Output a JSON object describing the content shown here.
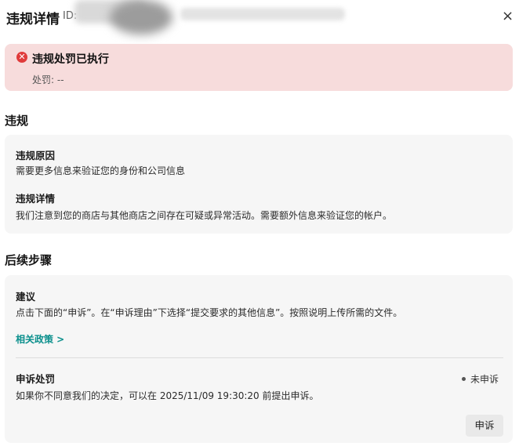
{
  "header": {
    "title": "违规详情",
    "id_label": "ID:",
    "close_icon": "×"
  },
  "alert": {
    "icon": "✕",
    "title": "违规处罚已执行",
    "penalty": "处罚: --",
    "color": "#f7dcdc"
  },
  "violation": {
    "section_title": "违规",
    "reason_label": "违规原因",
    "reason_text": "需要更多信息来验证您的身份和公司信息",
    "detail_label": "违规详情",
    "detail_text": "我们注意到您的商店与其他商店之间存在可疑或异常活动。需要额外信息来验证您的帐户。"
  },
  "next_steps": {
    "section_title": "后续步骤",
    "suggestion_label": "建议",
    "suggestion_text": "点击下面的“申诉”。在“申诉理由”下选择“提交要求的其他信息”。按照说明上传所需的文件。",
    "policy_link": "相关政策 >",
    "appeal_label": "申诉处罚",
    "status": "未申诉",
    "appeal_text": "如果你不同意我们的决定，可以在 2025/11/09 19:30:20 前提出申诉。",
    "appeal_button": "申诉"
  }
}
